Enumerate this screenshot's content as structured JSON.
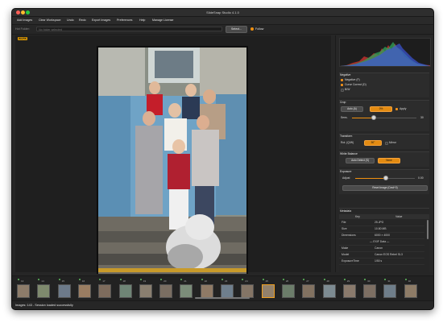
{
  "window": {
    "title": "SlideSnap Studio 4.1.0"
  },
  "menu": [
    "Add Images",
    "Clear Workspace",
    "Undo",
    "Redo",
    "Export Images",
    "Preferences",
    "Help",
    "Manage License"
  ],
  "folder": {
    "label": "Hot Folder:",
    "placeholder": "No folder selected",
    "select_label": "Select...",
    "follow_label": "Follow",
    "follow_checked": true
  },
  "canvas": {
    "badge": "WORK"
  },
  "negative": {
    "title": "Negative",
    "items": [
      {
        "label": "Negative (F)",
        "checked": true
      },
      {
        "label": "Curve Correct (D)",
        "checked": true
      },
      {
        "label": "B/W",
        "checked": false
      }
    ]
  },
  "crop": {
    "title": "Crop",
    "auto_label": "Auto (A)",
    "percent": "0%",
    "apply_label": "Apply",
    "apply_checked": true,
    "sens_label": "Sens.",
    "sens_value": "30",
    "sens_level": 0.32
  },
  "transform": {
    "title": "Transform",
    "rot_label": "Rot. (Q/W)",
    "rot_value": "90°",
    "mirror_label": "Mirror",
    "mirror_checked": false
  },
  "white_balance": {
    "title": "White Balance",
    "auto_label": "Auto Detect (S)",
    "mode": "None"
  },
  "exposure": {
    "title": "Exposure",
    "adjust_label": "Adjust",
    "value": "0.00",
    "level": 0.5,
    "reset_label": "Reset Image (Cmd+0)"
  },
  "metadata": {
    "title": "Metadata",
    "col_key": "Key",
    "col_value": "Value",
    "rows": [
      {
        "key": "File",
        "value": "25.JPG"
      },
      {
        "key": "Size",
        "value": "10.80 MB"
      },
      {
        "key": "Dimensions",
        "value": "6000 × 4000"
      },
      {
        "key": "",
        "value": "— EXIF Data —"
      },
      {
        "key": "Make",
        "value": "Canon"
      },
      {
        "key": "Model",
        "value": "Canon EOS Rebel SL3"
      },
      {
        "key": "ExposureTime",
        "value": "1/50 s"
      }
    ]
  },
  "filmstrip": {
    "numbers": [
      "13",
      "14",
      "15",
      "16",
      "17",
      "18",
      "19",
      "20",
      "21",
      "22",
      "23",
      "24",
      "25",
      "26",
      "27",
      "28",
      "29",
      "30",
      "31",
      "32"
    ]
  },
  "status": {
    "text": "Images: 143 - Session loaded successfully"
  }
}
